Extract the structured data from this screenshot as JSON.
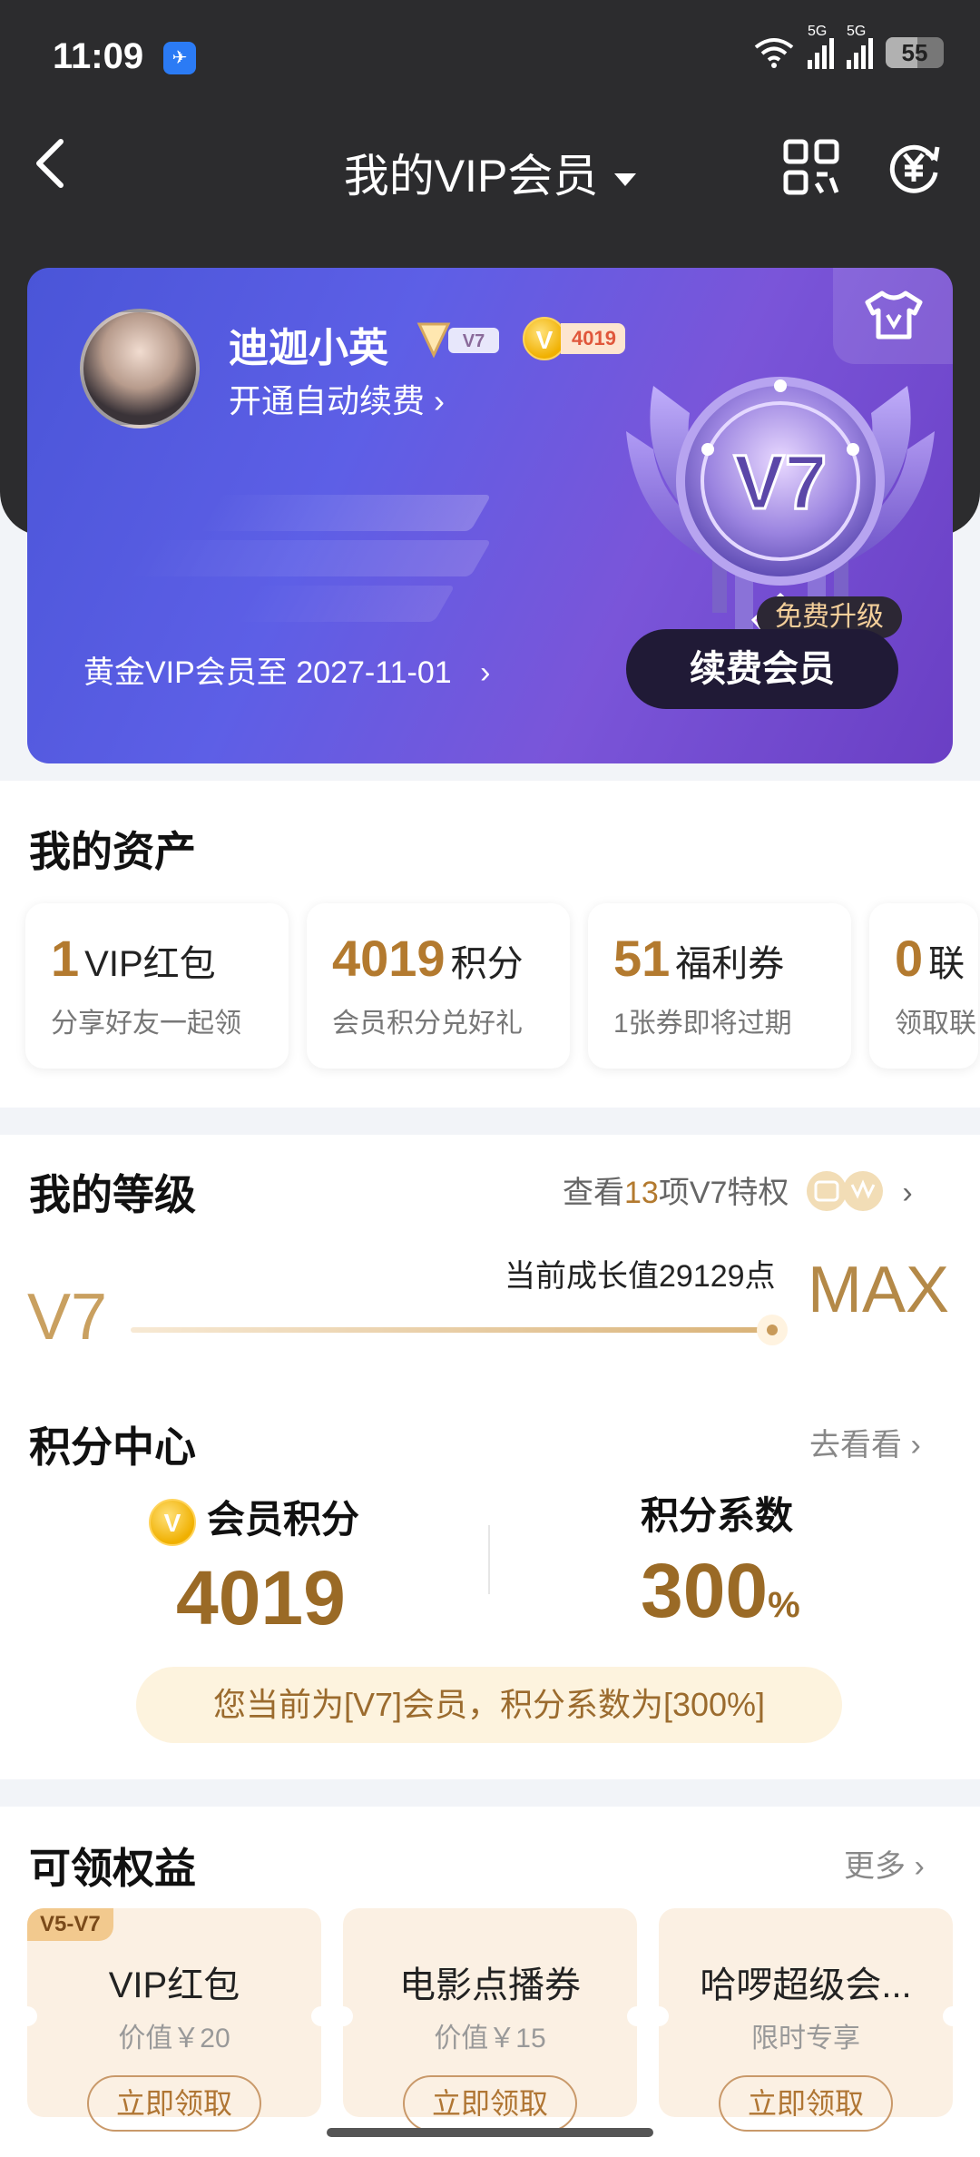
{
  "status_bar": {
    "time": "11:09",
    "network": "5G",
    "battery": "55"
  },
  "navbar": {
    "title": "我的VIP会员"
  },
  "vip_card": {
    "username": "迪迦小英",
    "level_badge": "V7",
    "points_badge": "4019",
    "auto_renew": "开通自动续费",
    "medal_level": "V7",
    "free_upgrade": "免费升级",
    "renew_button": "续费会员",
    "expire_text": "黄金VIP会员至 2027-11-01"
  },
  "assets": {
    "title": "我的资产",
    "items": [
      {
        "num": "1",
        "label": "VIP红包",
        "sub": "分享好友一起领"
      },
      {
        "num": "4019",
        "label": "积分",
        "sub": "会员积分兑好礼"
      },
      {
        "num": "51",
        "label": "福利券",
        "sub": "1张券即将过期"
      },
      {
        "num": "0",
        "label": "联",
        "sub": "领取联"
      }
    ]
  },
  "level": {
    "title": "我的等级",
    "link_prefix": "查看",
    "link_count": "13",
    "link_suffix": "项V7特权",
    "current": "V7",
    "max": "MAX",
    "growth_text": "当前成长值29129点",
    "progress": 1.0
  },
  "points_center": {
    "title": "积分中心",
    "more": "去看看",
    "points_label": "会员积分",
    "points_value": "4019",
    "coef_label": "积分系数",
    "coef_value": "300",
    "coef_unit": "%",
    "note": "您当前为[V7]会员，积分系数为[300%]"
  },
  "benefits": {
    "title": "可领权益",
    "more": "更多",
    "items": [
      {
        "tag": "V5-V7",
        "name": "VIP红包",
        "price": "价值￥20",
        "button": "立即领取"
      },
      {
        "tag": "",
        "name": "电影点播券",
        "price": "价值￥15",
        "button": "立即领取"
      },
      {
        "tag": "",
        "name": "哈啰超级会...",
        "price": "限时专享",
        "button": "立即领取"
      }
    ]
  },
  "colors": {
    "gold": "#b37a2f",
    "card_start": "#4a55d8",
    "card_end": "#6a3fc4",
    "header_bg": "#2c2c2e"
  }
}
